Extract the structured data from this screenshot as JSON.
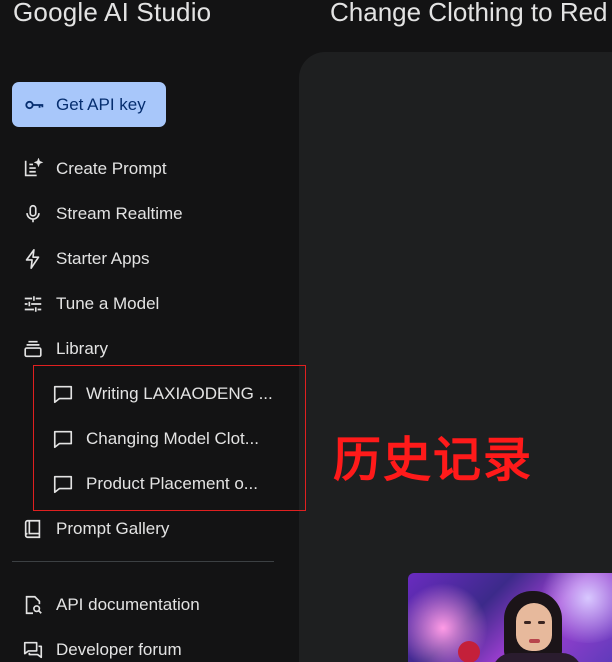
{
  "header": {
    "brand": "Google AI Studio",
    "page_title": "Change Clothing to Red"
  },
  "sidebar": {
    "api_key_button": {
      "label": "Get API key",
      "icon": "key-icon"
    },
    "items": [
      {
        "label": "Create Prompt",
        "icon": "create-prompt-icon"
      },
      {
        "label": "Stream Realtime",
        "icon": "microphone-icon"
      },
      {
        "label": "Starter Apps",
        "icon": "lightning-icon"
      },
      {
        "label": "Tune a Model",
        "icon": "tune-icon"
      },
      {
        "label": "Library",
        "icon": "library-icon"
      }
    ],
    "library_items": [
      {
        "label": "Writing LAXIAODENG ...",
        "icon": "chat-bubble-icon"
      },
      {
        "label": "Changing Model Clot...",
        "icon": "chat-bubble-icon"
      },
      {
        "label": "Product Placement o...",
        "icon": "chat-bubble-icon"
      }
    ],
    "prompt_gallery": {
      "label": "Prompt Gallery",
      "icon": "book-icon"
    },
    "bottom_items": [
      {
        "label": "API documentation",
        "icon": "docs-search-icon"
      },
      {
        "label": "Developer forum",
        "icon": "forum-icon"
      }
    ]
  },
  "annotation": {
    "text": "历史记录",
    "color": "#ff1a1a"
  },
  "colors": {
    "background": "#131314",
    "panel": "#1e1f20",
    "accent_button": "#a8c7fa",
    "highlight_box": "#e02020"
  }
}
